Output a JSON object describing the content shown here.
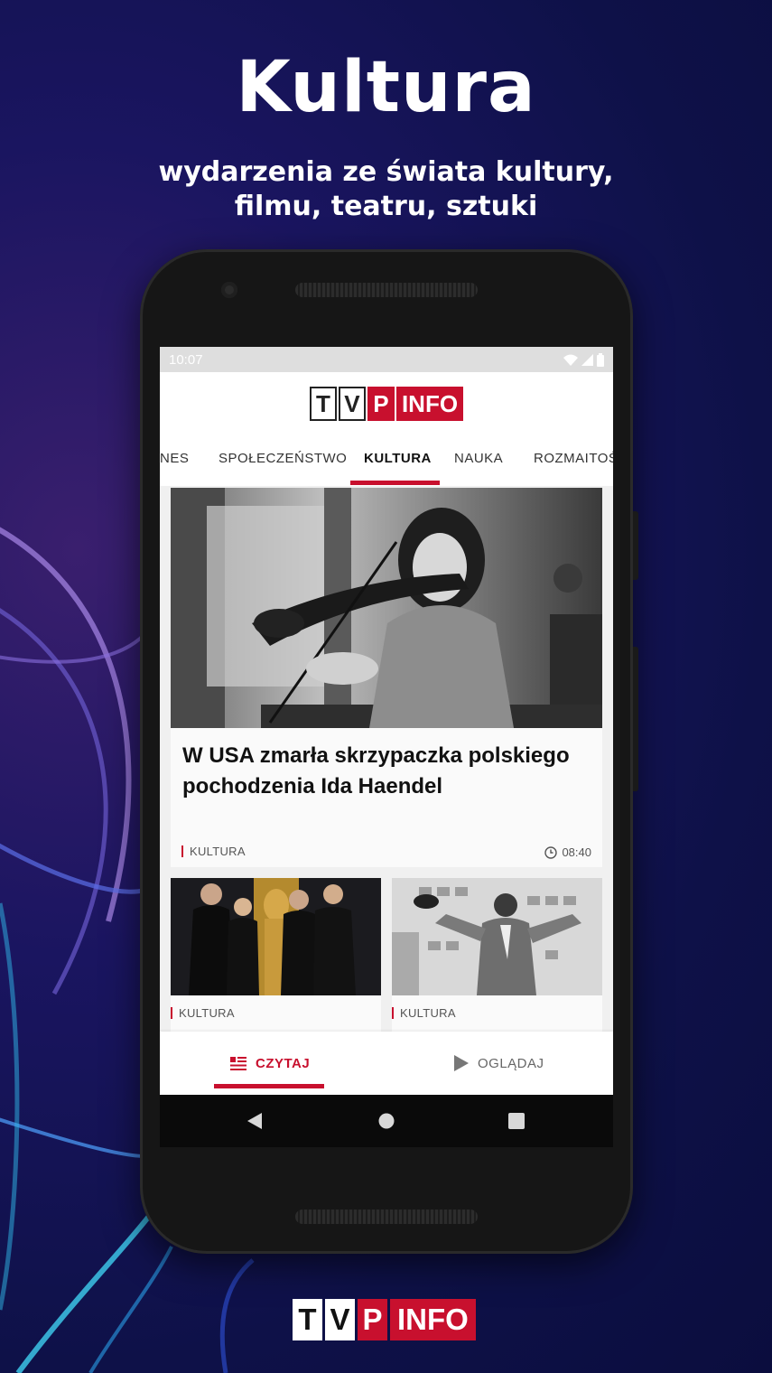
{
  "promo": {
    "headline": "Kultura",
    "subline_1": "wydarzenia ze świata kultury,",
    "subline_2": "filmu, teatru, sztuki"
  },
  "status_bar": {
    "time": "10:07"
  },
  "app": {
    "logo_letters": [
      "T",
      "V",
      "P"
    ],
    "logo_info": "INFO",
    "brand_color": "#c8102e"
  },
  "tabs": [
    "NES",
    "SPOŁECZEŃSTWO",
    "KULTURA",
    "NAUKA",
    "ROZMAITOŚ"
  ],
  "active_tab": "KULTURA",
  "feed": {
    "main_article": {
      "title": "W USA zmarła skrzypaczka polskiego pochodzenia Ida Haendel",
      "category": "KULTURA",
      "time": "08:40"
    },
    "small_articles": [
      {
        "category": "KULTURA"
      },
      {
        "category": "KULTURA"
      }
    ]
  },
  "bottom_nav": {
    "read_label": "CZYTAJ",
    "watch_label": "OGLĄDAJ"
  },
  "footer_logo": {
    "letters": [
      "T",
      "V",
      "P"
    ],
    "info": "INFO"
  }
}
